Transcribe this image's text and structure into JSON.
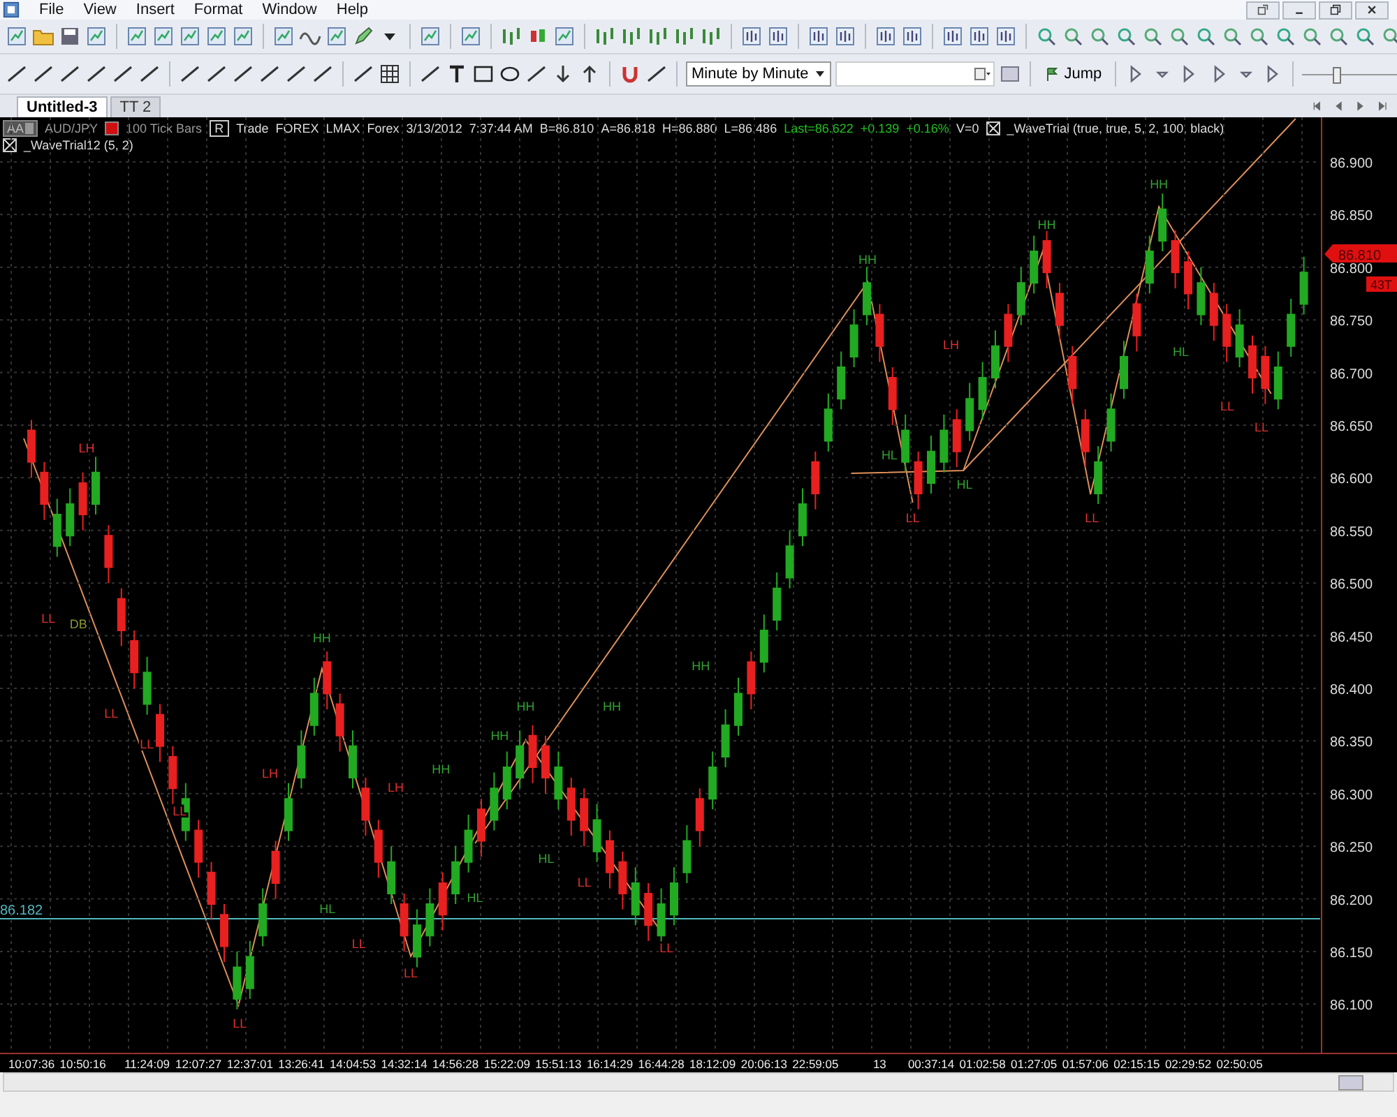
{
  "menu": [
    "File",
    "View",
    "Insert",
    "Format",
    "Window",
    "Help"
  ],
  "toolbar": {
    "interval": "Minute by Minute",
    "jump": "Jump",
    "zoom_slider": {
      "level": 0.33
    }
  },
  "tabs": [
    {
      "label": "Untitled-3",
      "selected": true
    },
    {
      "label": "TT 2",
      "selected": false
    }
  ],
  "chart_header": {
    "workspace": "AA",
    "symbol": "AUD/JPY",
    "bar_type": "100 Tick Bars",
    "r_button": "R",
    "fields": [
      "Trade",
      "FOREX",
      "LMAX",
      "Forex",
      "3/13/2012",
      "7:37:44 AM",
      "B=86.810",
      "A=86.818",
      "H=86.880",
      "L=86.486"
    ],
    "last": [
      "Last=86.622",
      "+0.139",
      "+0.16%"
    ],
    "volume": "V=0",
    "studies": [
      {
        "label": "_WaveTrial (true, true, 5, 2, 100, black)",
        "checked": true
      },
      {
        "label": "_WaveTrial12 (5, 2)",
        "checked": true
      }
    ]
  },
  "chart_data": {
    "type": "candlestick",
    "x": [
      "10:07:36",
      null,
      null,
      null,
      "10:50:16",
      null,
      null,
      null,
      null,
      "11:24:09",
      null,
      null,
      null,
      "12:07:27",
      null,
      null,
      null,
      "12:37:01",
      null,
      null,
      null,
      "13:26:41",
      null,
      null,
      null,
      "14:04:53",
      null,
      null,
      null,
      "14:32:14",
      null,
      null,
      null,
      "14:56:28",
      null,
      null,
      null,
      "15:22:09",
      null,
      null,
      null,
      "15:51:13",
      null,
      null,
      null,
      "16:14:29",
      null,
      null,
      null,
      "16:44:28",
      null,
      null,
      null,
      "18:12:09",
      null,
      null,
      null,
      "20:06:13",
      null,
      null,
      null,
      "22:59:05",
      null,
      null,
      null,
      null,
      "13",
      null,
      null,
      null,
      "00:37:14",
      null,
      null,
      null,
      "01:02:58",
      null,
      null,
      null,
      "01:27:05",
      null,
      null,
      null,
      "01:57:06",
      null,
      null,
      null,
      "02:15:15",
      null,
      null,
      null,
      "02:29:52",
      null,
      null,
      null,
      "02:50:05",
      null,
      null,
      null,
      null,
      null
    ],
    "ohlc": [
      [
        86.645,
        86.655,
        86.6,
        86.615
      ],
      [
        86.605,
        86.615,
        86.56,
        86.575
      ],
      [
        86.535,
        86.58,
        86.525,
        86.565
      ],
      [
        86.545,
        86.59,
        86.535,
        86.575
      ],
      [
        86.595,
        86.605,
        86.55,
        86.565
      ],
      [
        86.575,
        86.62,
        86.565,
        86.605
      ],
      [
        86.545,
        86.555,
        86.5,
        86.515
      ],
      [
        86.485,
        86.495,
        86.44,
        86.455
      ],
      [
        86.445,
        86.455,
        86.4,
        86.415
      ],
      [
        86.385,
        86.43,
        86.375,
        86.415
      ],
      [
        86.375,
        86.385,
        86.33,
        86.345
      ],
      [
        86.335,
        86.345,
        86.29,
        86.305
      ],
      [
        86.265,
        86.31,
        86.255,
        86.295
      ],
      [
        86.265,
        86.275,
        86.22,
        86.235
      ],
      [
        86.225,
        86.235,
        86.18,
        86.195
      ],
      [
        86.185,
        86.195,
        86.14,
        86.155
      ],
      [
        86.105,
        86.15,
        86.095,
        86.135
      ],
      [
        86.115,
        86.16,
        86.105,
        86.145
      ],
      [
        86.165,
        86.21,
        86.155,
        86.195
      ],
      [
        86.245,
        86.255,
        86.2,
        86.215
      ],
      [
        86.265,
        86.31,
        86.255,
        86.295
      ],
      [
        86.315,
        86.36,
        86.305,
        86.345
      ],
      [
        86.365,
        86.41,
        86.355,
        86.395
      ],
      [
        86.425,
        86.435,
        86.38,
        86.395
      ],
      [
        86.385,
        86.395,
        86.34,
        86.355
      ],
      [
        86.315,
        86.36,
        86.305,
        86.345
      ],
      [
        86.305,
        86.315,
        86.26,
        86.275
      ],
      [
        86.265,
        86.275,
        86.22,
        86.235
      ],
      [
        86.205,
        86.25,
        86.195,
        86.235
      ],
      [
        86.195,
        86.205,
        86.15,
        86.165
      ],
      [
        86.145,
        86.19,
        86.135,
        86.175
      ],
      [
        86.165,
        86.21,
        86.155,
        86.195
      ],
      [
        86.215,
        86.225,
        86.17,
        86.185
      ],
      [
        86.205,
        86.25,
        86.195,
        86.235
      ],
      [
        86.235,
        86.28,
        86.225,
        86.265
      ],
      [
        86.285,
        86.295,
        86.24,
        86.255
      ],
      [
        86.275,
        86.32,
        86.265,
        86.305
      ],
      [
        86.295,
        86.34,
        86.285,
        86.325
      ],
      [
        86.315,
        86.36,
        86.305,
        86.345
      ],
      [
        86.355,
        86.365,
        86.31,
        86.325
      ],
      [
        86.345,
        86.355,
        86.3,
        86.315
      ],
      [
        86.295,
        86.34,
        86.285,
        86.325
      ],
      [
        86.305,
        86.315,
        86.26,
        86.275
      ],
      [
        86.295,
        86.305,
        86.25,
        86.265
      ],
      [
        86.245,
        86.29,
        86.235,
        86.275
      ],
      [
        86.255,
        86.265,
        86.21,
        86.225
      ],
      [
        86.235,
        86.245,
        86.19,
        86.205
      ],
      [
        86.185,
        86.23,
        86.175,
        86.215
      ],
      [
        86.205,
        86.215,
        86.16,
        86.175
      ],
      [
        86.165,
        86.21,
        86.155,
        86.195
      ],
      [
        86.185,
        86.23,
        86.175,
        86.215
      ],
      [
        86.225,
        86.27,
        86.215,
        86.255
      ],
      [
        86.295,
        86.305,
        86.25,
        86.265
      ],
      [
        86.295,
        86.34,
        86.285,
        86.325
      ],
      [
        86.335,
        86.38,
        86.325,
        86.365
      ],
      [
        86.365,
        86.41,
        86.355,
        86.395
      ],
      [
        86.425,
        86.435,
        86.38,
        86.395
      ],
      [
        86.425,
        86.47,
        86.415,
        86.455
      ],
      [
        86.465,
        86.51,
        86.455,
        86.495
      ],
      [
        86.505,
        86.55,
        86.495,
        86.535
      ],
      [
        86.545,
        86.59,
        86.535,
        86.575
      ],
      [
        86.615,
        86.625,
        86.57,
        86.585
      ],
      [
        86.635,
        86.68,
        86.625,
        86.665
      ],
      [
        86.675,
        86.72,
        86.665,
        86.705
      ],
      [
        86.715,
        86.76,
        86.705,
        86.745
      ],
      [
        86.755,
        86.8,
        86.745,
        86.785
      ],
      [
        86.755,
        86.765,
        86.71,
        86.725
      ],
      [
        86.695,
        86.705,
        86.65,
        86.665
      ],
      [
        86.615,
        86.66,
        86.605,
        86.645
      ],
      [
        86.615,
        86.625,
        86.57,
        86.585
      ],
      [
        86.595,
        86.64,
        86.585,
        86.625
      ],
      [
        86.615,
        86.66,
        86.605,
        86.645
      ],
      [
        86.655,
        86.665,
        86.61,
        86.625
      ],
      [
        86.645,
        86.69,
        86.635,
        86.675
      ],
      [
        86.665,
        86.71,
        86.655,
        86.695
      ],
      [
        86.695,
        86.74,
        86.685,
        86.725
      ],
      [
        86.755,
        86.765,
        86.71,
        86.725
      ],
      [
        86.755,
        86.8,
        86.745,
        86.785
      ],
      [
        86.785,
        86.83,
        86.775,
        86.815
      ],
      [
        86.825,
        86.835,
        86.78,
        86.795
      ],
      [
        86.775,
        86.785,
        86.73,
        86.745
      ],
      [
        86.715,
        86.725,
        86.67,
        86.685
      ],
      [
        86.655,
        86.665,
        86.61,
        86.625
      ],
      [
        86.585,
        86.63,
        86.575,
        86.615
      ],
      [
        86.635,
        86.68,
        86.625,
        86.665
      ],
      [
        86.685,
        86.73,
        86.675,
        86.715
      ],
      [
        86.765,
        86.775,
        86.72,
        86.735
      ],
      [
        86.785,
        86.83,
        86.775,
        86.815
      ],
      [
        86.825,
        86.87,
        86.815,
        86.855
      ],
      [
        86.825,
        86.835,
        86.78,
        86.795
      ],
      [
        86.805,
        86.815,
        86.76,
        86.775
      ],
      [
        86.755,
        86.8,
        86.745,
        86.785
      ],
      [
        86.775,
        86.785,
        86.73,
        86.745
      ],
      [
        86.755,
        86.765,
        86.71,
        86.725
      ],
      [
        86.715,
        86.76,
        86.705,
        86.745
      ],
      [
        86.725,
        86.735,
        86.68,
        86.695
      ],
      [
        86.715,
        86.725,
        86.67,
        86.685
      ],
      [
        86.675,
        86.72,
        86.665,
        86.705
      ],
      [
        86.725,
        86.77,
        86.715,
        86.755
      ],
      [
        86.765,
        86.81,
        86.755,
        86.795
      ]
    ],
    "ylim": [
      86.0538,
      86.9424
    ],
    "yticks": [
      {
        "value": 86.9,
        "label": "86.900"
      },
      {
        "value": 86.85,
        "label": "86.850"
      },
      {
        "value": 86.8,
        "label": "86.800"
      },
      {
        "value": 86.75,
        "label": "86.750"
      },
      {
        "value": 86.7,
        "label": "86.700"
      },
      {
        "value": 86.65,
        "label": "86.650"
      },
      {
        "value": 86.6,
        "label": "86.600"
      },
      {
        "value": 86.55,
        "label": "86.550"
      },
      {
        "value": 86.5,
        "label": "86.500"
      },
      {
        "value": 86.45,
        "label": "86.450"
      },
      {
        "value": 86.4,
        "label": "86.400"
      },
      {
        "value": 86.35,
        "label": "86.350"
      },
      {
        "value": 86.3,
        "label": "86.300"
      },
      {
        "value": 86.25,
        "label": "86.250"
      },
      {
        "value": 86.2,
        "label": "86.200"
      },
      {
        "value": 86.15,
        "label": "86.150"
      },
      {
        "value": 86.1,
        "label": "86.100"
      }
    ],
    "grid": true
  },
  "price_line": {
    "label": "86.182"
  },
  "last_price": {
    "price": "86.810",
    "ticks": "43T"
  },
  "wave_labels": [
    {
      "text": "LH",
      "color": "#e03030"
    },
    {
      "text": "LL",
      "color": "#e03030"
    },
    {
      "text": "DB",
      "color": "#8a9a30"
    },
    {
      "text": "LL",
      "color": "#e03030"
    },
    {
      "text": "LL",
      "color": "#e03030"
    },
    {
      "text": "LL",
      "color": "#e03030"
    },
    {
      "text": "HH",
      "color": "#30a030"
    },
    {
      "text": "LH",
      "color": "#e03030"
    },
    {
      "text": "LL",
      "color": "#e03030"
    },
    {
      "text": "HL",
      "color": "#30a030"
    },
    {
      "text": "LH",
      "color": "#e03030"
    },
    {
      "text": "LL",
      "color": "#e03030"
    },
    {
      "text": "LL",
      "color": "#e03030"
    },
    {
      "text": "HH",
      "color": "#30a030"
    },
    {
      "text": "HH",
      "color": "#30a030"
    },
    {
      "text": "HL",
      "color": "#30a030"
    },
    {
      "text": "HH",
      "color": "#30a030"
    },
    {
      "text": "HL",
      "color": "#30a030"
    },
    {
      "text": "LL",
      "color": "#e03030"
    },
    {
      "text": "HH",
      "color": "#30a030"
    },
    {
      "text": "LL",
      "color": "#e03030"
    },
    {
      "text": "HH",
      "color": "#30a030"
    },
    {
      "text": "HH",
      "color": "#30a030"
    },
    {
      "text": "LH",
      "color": "#e03030"
    },
    {
      "text": "HL",
      "color": "#30a030"
    },
    {
      "text": "LL",
      "color": "#e03030"
    },
    {
      "text": "HL",
      "color": "#30a030"
    },
    {
      "text": "HH",
      "color": "#30a030"
    },
    {
      "text": "LL",
      "color": "#e03030"
    },
    {
      "text": "HH",
      "color": "#30a030"
    },
    {
      "text": "HL",
      "color": "#30a030"
    },
    {
      "text": "LL",
      "color": "#e03030"
    },
    {
      "text": "LL",
      "color": "#e03030"
    }
  ]
}
